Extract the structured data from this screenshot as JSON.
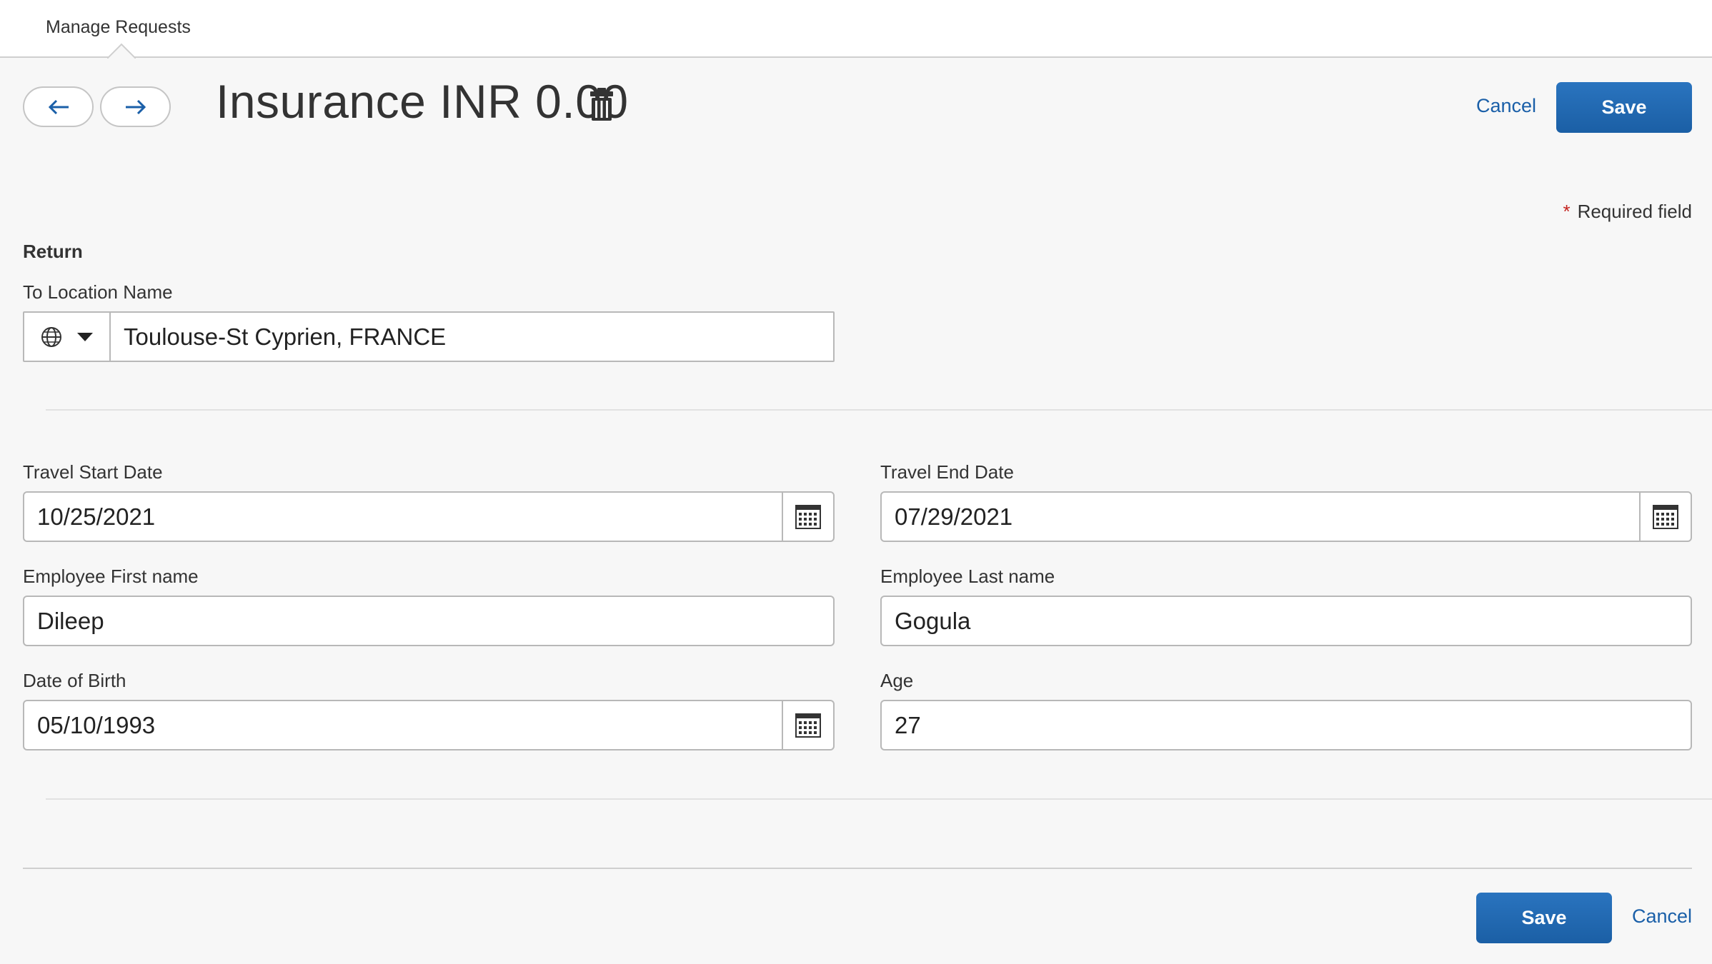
{
  "tab": {
    "label": "Manage Requests"
  },
  "header": {
    "title": "Insurance INR 0.00",
    "cancel_label": "Cancel",
    "save_label": "Save"
  },
  "required_note": {
    "star": "*",
    "text": "Required field"
  },
  "section": {
    "heading": "Return"
  },
  "to_location": {
    "label": "To Location Name",
    "value": "Toulouse-St Cyprien, FRANCE"
  },
  "fields": {
    "travel_start": {
      "label": "Travel Start Date",
      "value": "10/25/2021"
    },
    "travel_end": {
      "label": "Travel End Date",
      "value": "07/29/2021"
    },
    "first_name": {
      "label": "Employee First name",
      "value": "Dileep"
    },
    "last_name": {
      "label": "Employee Last name",
      "value": "Gogula"
    },
    "dob": {
      "label": "Date of Birth",
      "value": "05/10/1993"
    },
    "age": {
      "label": "Age",
      "value": "27"
    }
  },
  "footer": {
    "save_label": "Save",
    "cancel_label": "Cancel"
  },
  "colors": {
    "primary": "#2169b3",
    "link": "#1a5fa8",
    "required": "#c4231f"
  }
}
